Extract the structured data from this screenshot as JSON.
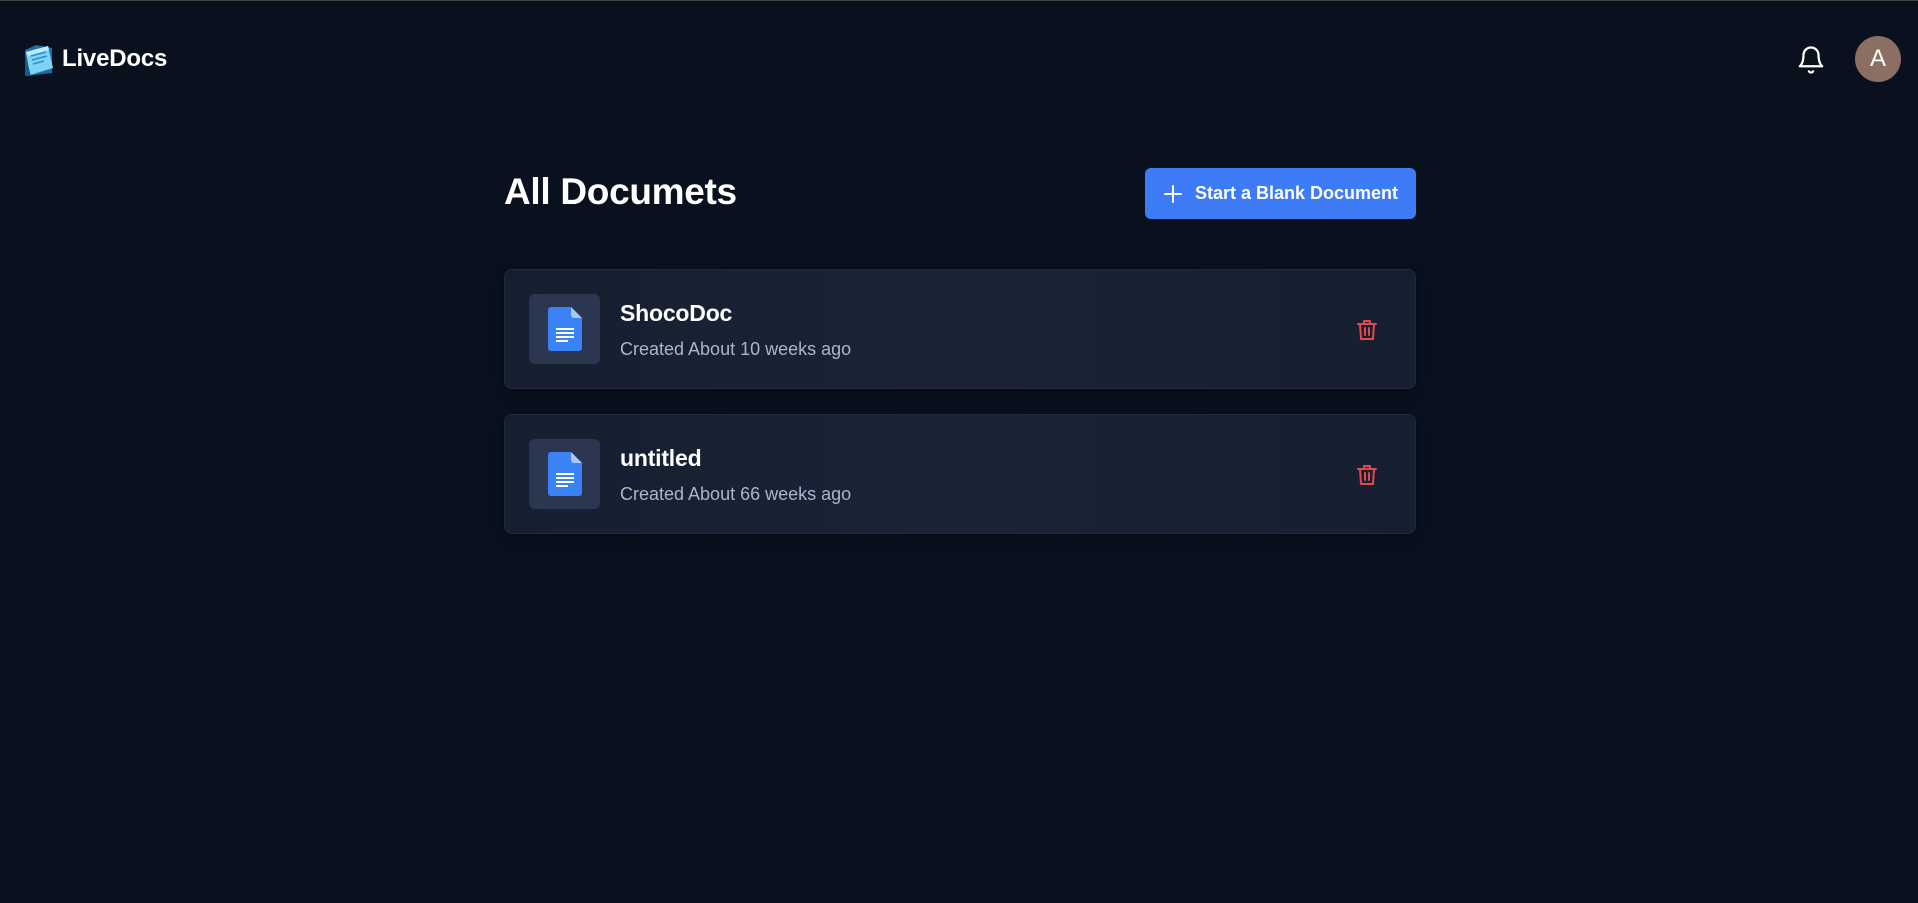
{
  "app": {
    "name": "LiveDocs"
  },
  "header": {
    "avatar_initial": "A",
    "notification_icon": "bell-icon"
  },
  "main": {
    "title": "All Documets",
    "new_document_button": "Start a Blank Document"
  },
  "documents": [
    {
      "name": "ShocoDoc",
      "created": "Created About 10 weeks ago"
    },
    {
      "name": "untitled",
      "created": "Created About 66 weeks ago"
    }
  ],
  "colors": {
    "background": "#09111f",
    "accent": "#3d7bf7",
    "card": "#1a2436",
    "danger": "#e5484d",
    "avatar": "#8d6e63",
    "doc_icon": "#3b82f6"
  }
}
